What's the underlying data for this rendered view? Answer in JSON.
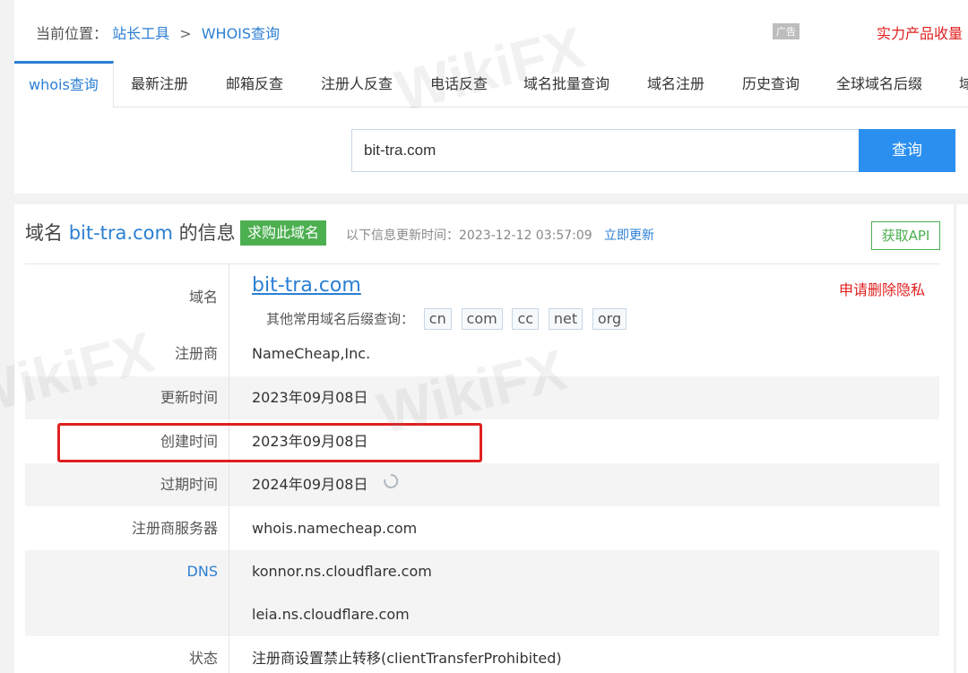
{
  "breadcrumb": {
    "prefix": "当前位置：",
    "home": "站长工具",
    "separator": ">",
    "current": "WHOIS查询"
  },
  "top_right": {
    "ad_tag": "广告",
    "promo": "实力产品收量"
  },
  "tabs": [
    {
      "label": "whois查询"
    },
    {
      "label": "最新注册"
    },
    {
      "label": "邮箱反查"
    },
    {
      "label": "注册人反查"
    },
    {
      "label": "电话反查"
    },
    {
      "label": "域名批量查询"
    },
    {
      "label": "域名注册"
    },
    {
      "label": "历史查询"
    },
    {
      "label": "全球域名后缀"
    },
    {
      "label": "域"
    }
  ],
  "search": {
    "value": "bit-tra.com",
    "button": "查询"
  },
  "info": {
    "title_prefix": "域名",
    "domain": "bit-tra.com",
    "title_suffix": "的信息",
    "buy_button": "求购此域名",
    "update_text": "以下信息更新时间：2023-12-12 03:57:09",
    "update_link": "立即更新",
    "api_button": "获取API",
    "domain_label": "域名",
    "domain_value": "bit-tra.com",
    "privacy_delete": "申请删除隐私",
    "suffix_prompt": "其他常用域名后缀查询：",
    "suffixes": [
      "cn",
      "com",
      "cc",
      "net",
      "org"
    ],
    "rows": [
      {
        "label": "注册商",
        "value": "NameCheap,Inc."
      },
      {
        "label": "更新时间",
        "value": "2023年09月08日"
      },
      {
        "label": "创建时间",
        "value": "2023年09月08日"
      },
      {
        "label": "过期时间",
        "value": "2024年09月08日"
      },
      {
        "label": "注册商服务器",
        "value": "whois.namecheap.com"
      },
      {
        "label": "DNS",
        "value": "konnor.ns.cloudflare.com"
      },
      {
        "label": "",
        "value": "leia.ns.cloudflare.com"
      },
      {
        "label": "状态",
        "value": "注册商设置禁止转移(clientTransferProhibited)"
      }
    ]
  },
  "watermark": "WikiFX",
  "colors": {
    "link": "#2b7fd3",
    "primary_button": "#2b8ff0",
    "success": "#4caf50",
    "alert": "#e02020"
  }
}
